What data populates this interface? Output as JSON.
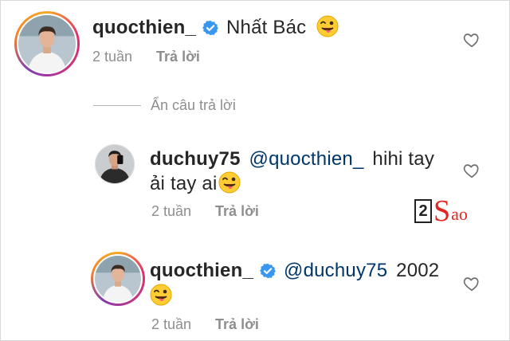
{
  "comments": [
    {
      "username": "quocthien_",
      "verified": true,
      "text": "Nhất Bác",
      "emoji": "winking-face-with-tongue",
      "time": "2 tuần",
      "reply_label": "Trả lời"
    },
    {
      "username": "duchuy75",
      "verified": false,
      "mention": "@quocthien_",
      "text_line1": "hihi tay",
      "text_line2": "ải tay ai",
      "emoji": "winking-face-with-tongue",
      "time": "2 tuần",
      "reply_label": "Trả lời"
    },
    {
      "username": "quocthien_",
      "verified": true,
      "mention": "@duchuy75",
      "text": "2002",
      "emoji": "winking-face-with-tongue",
      "time": "2 tuần",
      "reply_label": "Trả lời"
    }
  ],
  "hide_replies_label": "Ẩn câu trả lời",
  "watermark": {
    "box": "2",
    "s": "S",
    "rest": "ao"
  },
  "colors": {
    "text": "#262626",
    "secondary": "#8e8e8e",
    "mention": "#00376b",
    "verified": "#3897f0",
    "watermark_red": "#e52521"
  }
}
